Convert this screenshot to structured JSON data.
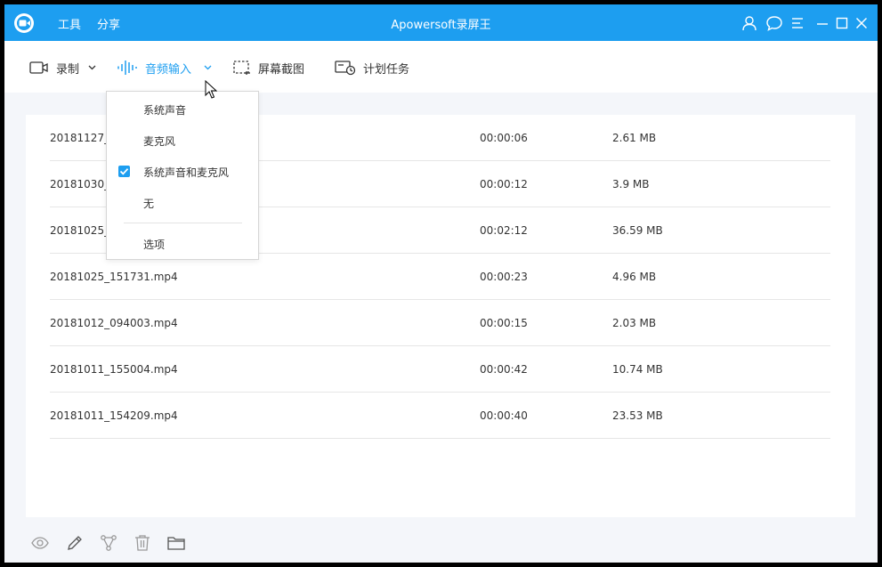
{
  "window": {
    "title": "Apowersoft录屏王",
    "menu": [
      {
        "label": "工具"
      },
      {
        "label": "分享"
      }
    ],
    "title_buttons": [
      "user-icon",
      "feedback-icon",
      "menu-icon",
      "minimize-icon",
      "maximize-icon",
      "close-icon"
    ]
  },
  "toolbar": {
    "record_label": "录制",
    "audio_label": "音频输入",
    "screenshot_label": "屏幕截图",
    "schedule_label": "计划任务"
  },
  "audio_dropdown": {
    "items": [
      {
        "label": "系统声音",
        "checked": false
      },
      {
        "label": "麦克风",
        "checked": false
      },
      {
        "label": "系统声音和麦克风",
        "checked": true
      },
      {
        "label": "无",
        "checked": false
      }
    ],
    "options_label": "选项"
  },
  "files": [
    {
      "name": "20181127_1",
      "duration": "00:00:06",
      "size": "2.61 MB"
    },
    {
      "name": "20181030_1",
      "duration": "00:00:12",
      "size": "3.9 MB"
    },
    {
      "name": "20181025_1",
      "duration": "00:02:12",
      "size": "36.59 MB"
    },
    {
      "name": "20181025_151731.mp4",
      "duration": "00:00:23",
      "size": "4.96 MB"
    },
    {
      "name": "20181012_094003.mp4",
      "duration": "00:00:15",
      "size": "2.03 MB"
    },
    {
      "name": "20181011_155004.mp4",
      "duration": "00:00:42",
      "size": "10.74 MB"
    },
    {
      "name": "20181011_154209.mp4",
      "duration": "00:00:40",
      "size": "23.53 MB"
    }
  ],
  "footer_icons": [
    "eye-icon",
    "edit-icon",
    "share-icon",
    "trash-icon",
    "folder-icon"
  ],
  "colors": {
    "accent": "#1d9ef0",
    "background": "#f4f6fa"
  }
}
